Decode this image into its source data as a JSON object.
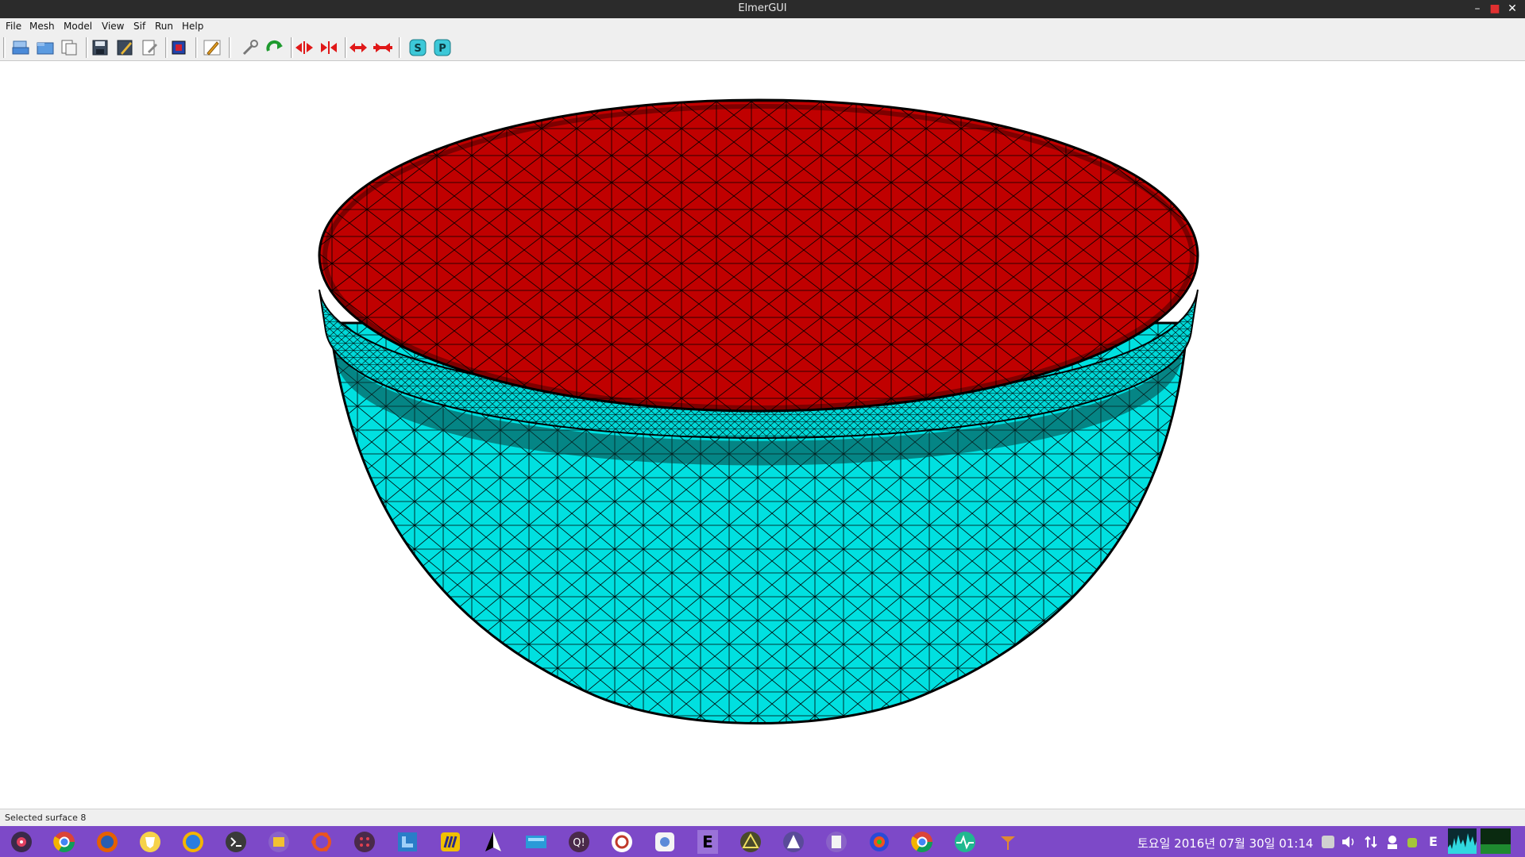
{
  "window": {
    "title": "ElmerGUI",
    "minimize_glyph": "–",
    "maximize_glyph": "■",
    "close_glyph": "✕"
  },
  "menu": {
    "items": [
      {
        "label": "File"
      },
      {
        "label": "Mesh"
      },
      {
        "label": "Model"
      },
      {
        "label": "View"
      },
      {
        "label": "Sif"
      },
      {
        "label": "Run"
      },
      {
        "label": "Help"
      }
    ]
  },
  "toolbar": {
    "icons": [
      "open-file-icon",
      "load-mesh-icon",
      "load-project-icon",
      "save-icon",
      "save-project-icon",
      "save-as-icon",
      "surface-mode-icon",
      "edit-pen-icon",
      "edit-tool-icon",
      "redo-icon",
      "divide-surface-icon",
      "unify-surface-icon",
      "divide-edge-icon",
      "unify-edge-icon",
      "start-solver-icon",
      "postprocessor-icon"
    ],
    "solver_letter": "S",
    "post_letter": "P"
  },
  "viewport": {
    "surface_colors": {
      "top_surface": "#c00000",
      "side_surface": "#00e0e0",
      "mesh_edges": "#000000"
    }
  },
  "status": {
    "text": "Selected surface 8"
  },
  "taskbar": {
    "background": "#7d49c8",
    "apps": [
      "app-menu-icon",
      "chrome-icon",
      "firefox-icon",
      "brave-icon",
      "browser-icon",
      "terminal-icon",
      "files-icon",
      "ubuntu-icon",
      "app-grid-icon",
      "lyx-icon",
      "color-bars-icon",
      "inkscape-icon",
      "monitor-icon",
      "q-icon",
      "sync-icon",
      "settings-icon",
      "elmer-icon",
      "warning-triangle-icon",
      "delta-icon",
      "text-editor-icon",
      "spiral-icon",
      "chrome-icon",
      "activity-monitor-icon",
      "misc-app-icon"
    ],
    "clock": "토요일 2016년 07월 30일 01:14",
    "tray_letter": "E"
  }
}
